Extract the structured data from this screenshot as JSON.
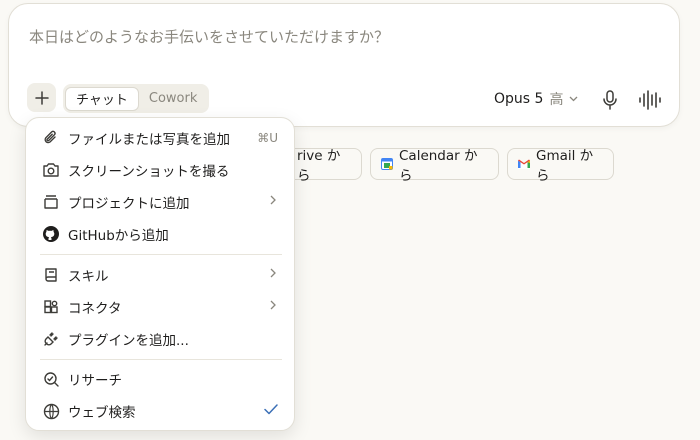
{
  "composer": {
    "placeholder": "本日はどのようなお手伝いをさせていただけますか？",
    "add_icon": "plus-icon",
    "modes": [
      "チャット",
      "Cowork"
    ],
    "active_mode": "チャット",
    "model": "Opus 5",
    "effort": "高",
    "mic_icon": "microphone-icon",
    "voice_icon": "voice-waveform-icon"
  },
  "chips": [
    {
      "label": "rive から",
      "icon": "google-drive-icon"
    },
    {
      "label": "Calendar から",
      "icon": "google-calendar-icon"
    },
    {
      "label": "Gmail から",
      "icon": "gmail-icon"
    }
  ],
  "menu": {
    "items": [
      {
        "label": "ファイルまたは写真を追加",
        "icon": "paperclip-icon",
        "shortcut": "⌘U"
      },
      {
        "label": "スクリーンショットを撮る",
        "icon": "camera-icon"
      },
      {
        "label": "プロジェクトに追加",
        "icon": "project-box-icon",
        "submenu": true
      },
      {
        "label": "GitHubから追加",
        "icon": "github-icon"
      },
      {
        "label": "スキル",
        "icon": "skill-book-icon",
        "submenu": true
      },
      {
        "label": "コネクタ",
        "icon": "connector-blocks-icon",
        "submenu": true
      },
      {
        "label": "プラグインを追加...",
        "icon": "plug-icon"
      },
      {
        "label": "リサーチ",
        "icon": "research-magnifier-icon"
      },
      {
        "label": "ウェブ検索",
        "icon": "globe-icon",
        "checked": true
      }
    ]
  },
  "colors": {
    "background": "#faf9f5",
    "surface": "#ffffff",
    "border": "#e2dfd6",
    "muted_text": "#8a877e",
    "check_accent": "#3b6fb6"
  }
}
